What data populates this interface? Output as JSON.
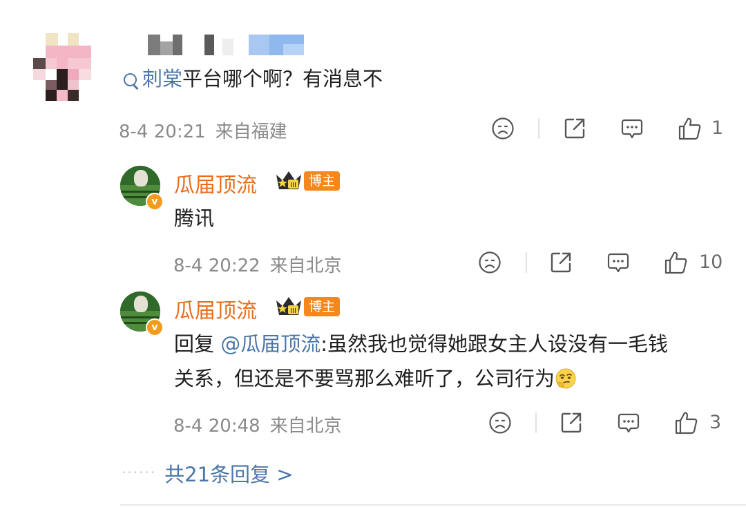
{
  "comment": {
    "topic_link": "刺棠",
    "text": "平台哪个啊？有消息不",
    "date": "8-4 20:21",
    "region": "来自福建",
    "likes": "1"
  },
  "replies": [
    {
      "author": "瓜届顶流",
      "badge": "博主",
      "text": "腾讯",
      "date": "8-4 20:22",
      "region": "来自北京",
      "likes": "10"
    },
    {
      "author": "瓜届顶流",
      "badge": "博主",
      "prefix": "回复 ",
      "mention": "@瓜届顶流",
      "line1": ":虽然我也觉得她跟女主人设没有一毛钱",
      "line2": "关系，但还是不要骂那么难听了，公司行为",
      "date": "8-4 20:48",
      "region": "来自北京",
      "likes": "3"
    }
  ],
  "more_replies": "共21条回复 >",
  "icons": {
    "dislike": "sad-face-icon",
    "share": "share-icon",
    "comment": "comment-icon",
    "like": "thumbs-up-icon",
    "search": "search-icon",
    "verified": "verified-v-icon",
    "crown": "crown-icon",
    "emoji": "thinking-emoji-icon"
  },
  "colors": {
    "link": "#4b76a8",
    "blogger": "#ea6d1b",
    "badge": "#f5871f",
    "meta": "#8a8a8a"
  }
}
